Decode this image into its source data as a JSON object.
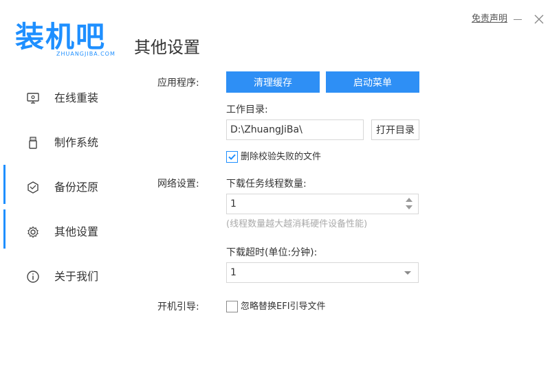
{
  "app": {
    "logo_text": "装机吧",
    "logo_sub": "ZHUANGJIBA.COM",
    "page_title": "其他设置",
    "disclaimer": "免责声明"
  },
  "sidebar": {
    "items": [
      {
        "label": "在线重装",
        "icon": "monitor-icon"
      },
      {
        "label": "制作系统",
        "icon": "usb-drive-icon"
      },
      {
        "label": "备份还原",
        "icon": "restore-cube-icon"
      },
      {
        "label": "其他设置",
        "icon": "gear-icon"
      },
      {
        "label": "关于我们",
        "icon": "info-circle-icon"
      }
    ],
    "active_index": 3
  },
  "settings": {
    "apps_label": "应用程序:",
    "clear_cache_label": "清理缓存",
    "boot_menu_label": "启动菜单",
    "work_dir_label": "工作目录:",
    "work_dir_value": "D:\\ZhuangJiBa\\",
    "open_dir_label": "打开目录",
    "delete_failed_label": "删除校验失败的文件",
    "delete_failed_checked": true,
    "network_label": "网络设置:",
    "threads_label": "下载任务线程数量:",
    "threads_value": "1",
    "threads_hint": "(线程数量越大越消耗硬件设备性能)",
    "timeout_label": "下载超时(单位:分钟):",
    "timeout_value": "1",
    "boot_label": "开机引导:",
    "ignore_efi_label": "忽略替换EFI引导文件",
    "ignore_efi_checked": false
  },
  "colors": {
    "accent": "#1e8fff",
    "button": "#2e8ff5"
  }
}
